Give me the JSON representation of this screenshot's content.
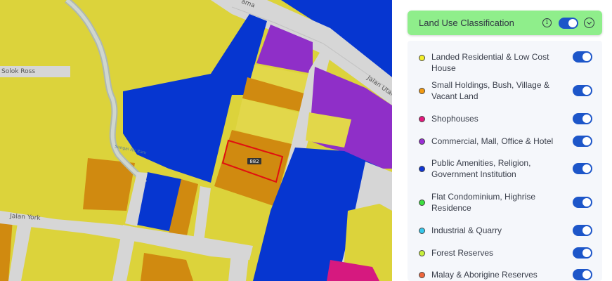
{
  "map": {
    "road_labels": [
      "Solok Ross",
      "Jalan York",
      "Jalan Utama",
      "ama"
    ],
    "river_label": "Sungai Air Itam",
    "parcel_label": "882",
    "colors": {
      "residential": "#dcd33b",
      "smallholding": "#d08a10",
      "commercial": "#8f2fc8",
      "public": "#0636d0",
      "shophouse": "#d6197f",
      "road": "#d4d4d4",
      "highlight": "#e01010"
    }
  },
  "panel": {
    "header": {
      "title": "Land Use Classification",
      "toggle_on": true
    },
    "items": [
      {
        "label": "Landed Residential & Low Cost House",
        "color": "#f4ef2a",
        "on": true
      },
      {
        "label": "Small Holdings, Bush, Village & Vacant Land",
        "color": "#f39a11",
        "on": true
      },
      {
        "label": "Shophouses",
        "color": "#e3197d",
        "on": true
      },
      {
        "label": "Commercial, Mall, Office & Hotel",
        "color": "#9b2fd6",
        "on": true
      },
      {
        "label": "Public Amenities, Religion, Government Institution",
        "color": "#1036d4",
        "on": true
      },
      {
        "label": "Flat Condominium, Highrise Residence",
        "color": "#3ce03f",
        "on": true
      },
      {
        "label": "Industrial & Quarry",
        "color": "#36c8ec",
        "on": true
      },
      {
        "label": "Forest Reserves",
        "color": "#c8f03c",
        "on": true
      },
      {
        "label": "Malay & Aborigine Reserves",
        "color": "#f0663c",
        "on": true
      }
    ]
  }
}
